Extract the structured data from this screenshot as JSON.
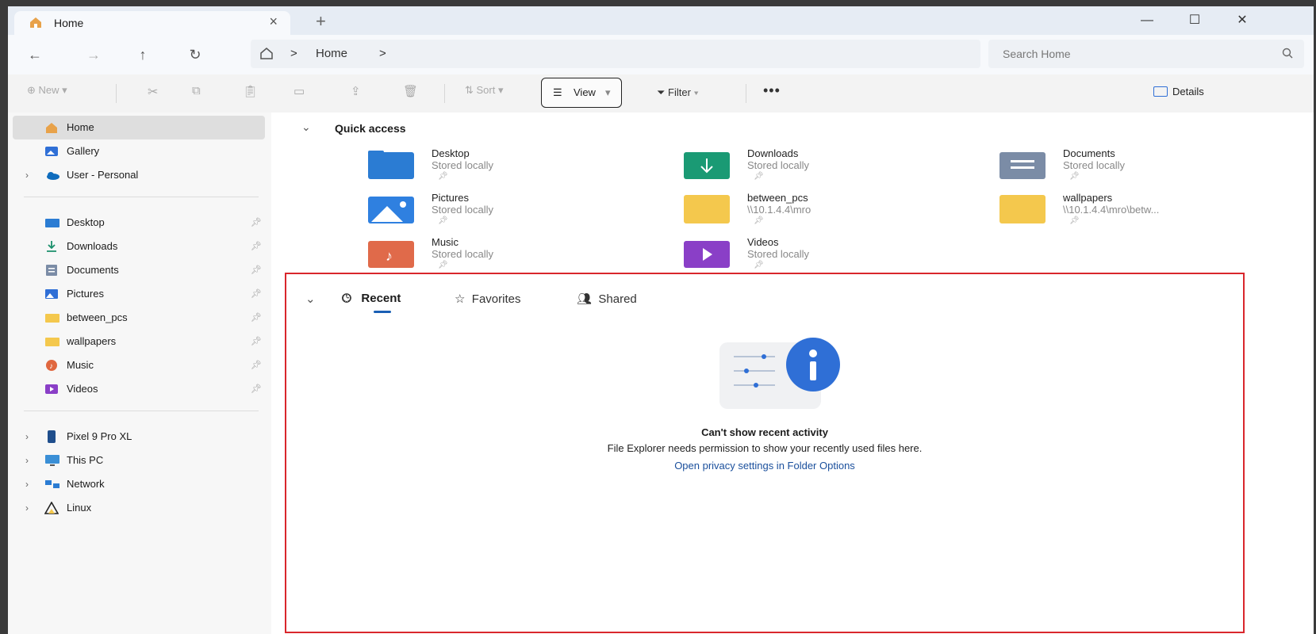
{
  "tab": {
    "title": "Home",
    "close": "×",
    "new": "+"
  },
  "window_controls": {
    "minimize": "—",
    "maximize": "☐",
    "close": "✕"
  },
  "nav": {
    "back": "←",
    "forward": "→",
    "up": "↑",
    "refresh": "↻",
    "crumbs": [
      "Home"
    ],
    "separator": ">"
  },
  "search": {
    "placeholder": "Search Home"
  },
  "commands": {
    "new": "New",
    "sort": "Sort",
    "view": "View",
    "filter": "Filter",
    "more": "•••",
    "details": "Details"
  },
  "sidebar": {
    "home": "Home",
    "gallery": "Gallery",
    "user": "User - Personal",
    "pinned": [
      "Desktop",
      "Downloads",
      "Documents",
      "Pictures",
      "between_pcs",
      "wallpapers",
      "Music",
      "Videos"
    ],
    "devices": [
      "Pixel 9 Pro XL",
      "This PC",
      "Network",
      "Linux"
    ]
  },
  "quick_access": {
    "title": "Quick access",
    "items": [
      {
        "name": "Desktop",
        "sub": "Stored locally"
      },
      {
        "name": "Downloads",
        "sub": "Stored locally"
      },
      {
        "name": "Documents",
        "sub": "Stored locally"
      },
      {
        "name": "Pictures",
        "sub": "Stored locally"
      },
      {
        "name": "between_pcs",
        "sub": "\\\\10.1.4.4\\mro"
      },
      {
        "name": "wallpapers",
        "sub": "\\\\10.1.4.4\\mro\\betw..."
      },
      {
        "name": "Music",
        "sub": "Stored locally"
      },
      {
        "name": "Videos",
        "sub": "Stored locally"
      }
    ]
  },
  "recent": {
    "tabs": [
      "Recent",
      "Favorites",
      "Shared"
    ],
    "title": "Can't show recent activity",
    "message": "File Explorer needs permission to show your recently used files here.",
    "link": "Open privacy settings in Folder Options"
  },
  "colors": {
    "accent": "#1a5fb4",
    "highlight_border": "#d9262c",
    "info": "#2f6fd6"
  }
}
